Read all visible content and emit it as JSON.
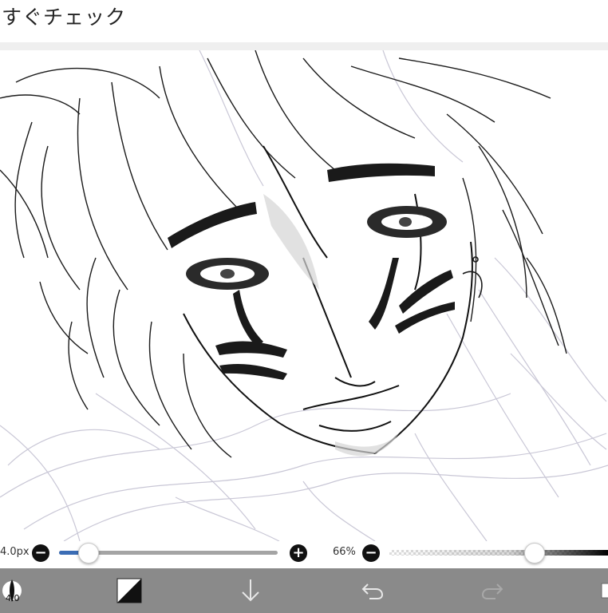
{
  "header": {
    "title": "すぐチェック"
  },
  "brush_size": {
    "label": "4.0px",
    "value_fraction": 0.13
  },
  "opacity": {
    "label": "66%",
    "value_fraction": 0.66
  },
  "toolbar": {
    "brush_size_badge": "4.0",
    "tools": [
      {
        "name": "brush",
        "icon": "brush-icon"
      },
      {
        "name": "color",
        "icon": "color-swatch-icon"
      },
      {
        "name": "download",
        "icon": "arrow-down-icon"
      },
      {
        "name": "undo",
        "icon": "undo-icon"
      },
      {
        "name": "redo",
        "icon": "redo-icon"
      },
      {
        "name": "layers",
        "icon": "layers-icon"
      }
    ]
  },
  "colors": {
    "toolbar_bg": "#8a8a8a",
    "slider_accent": "#3b6db5",
    "line_art": "#1a1a1a",
    "sketch": "#c9c7d6"
  }
}
